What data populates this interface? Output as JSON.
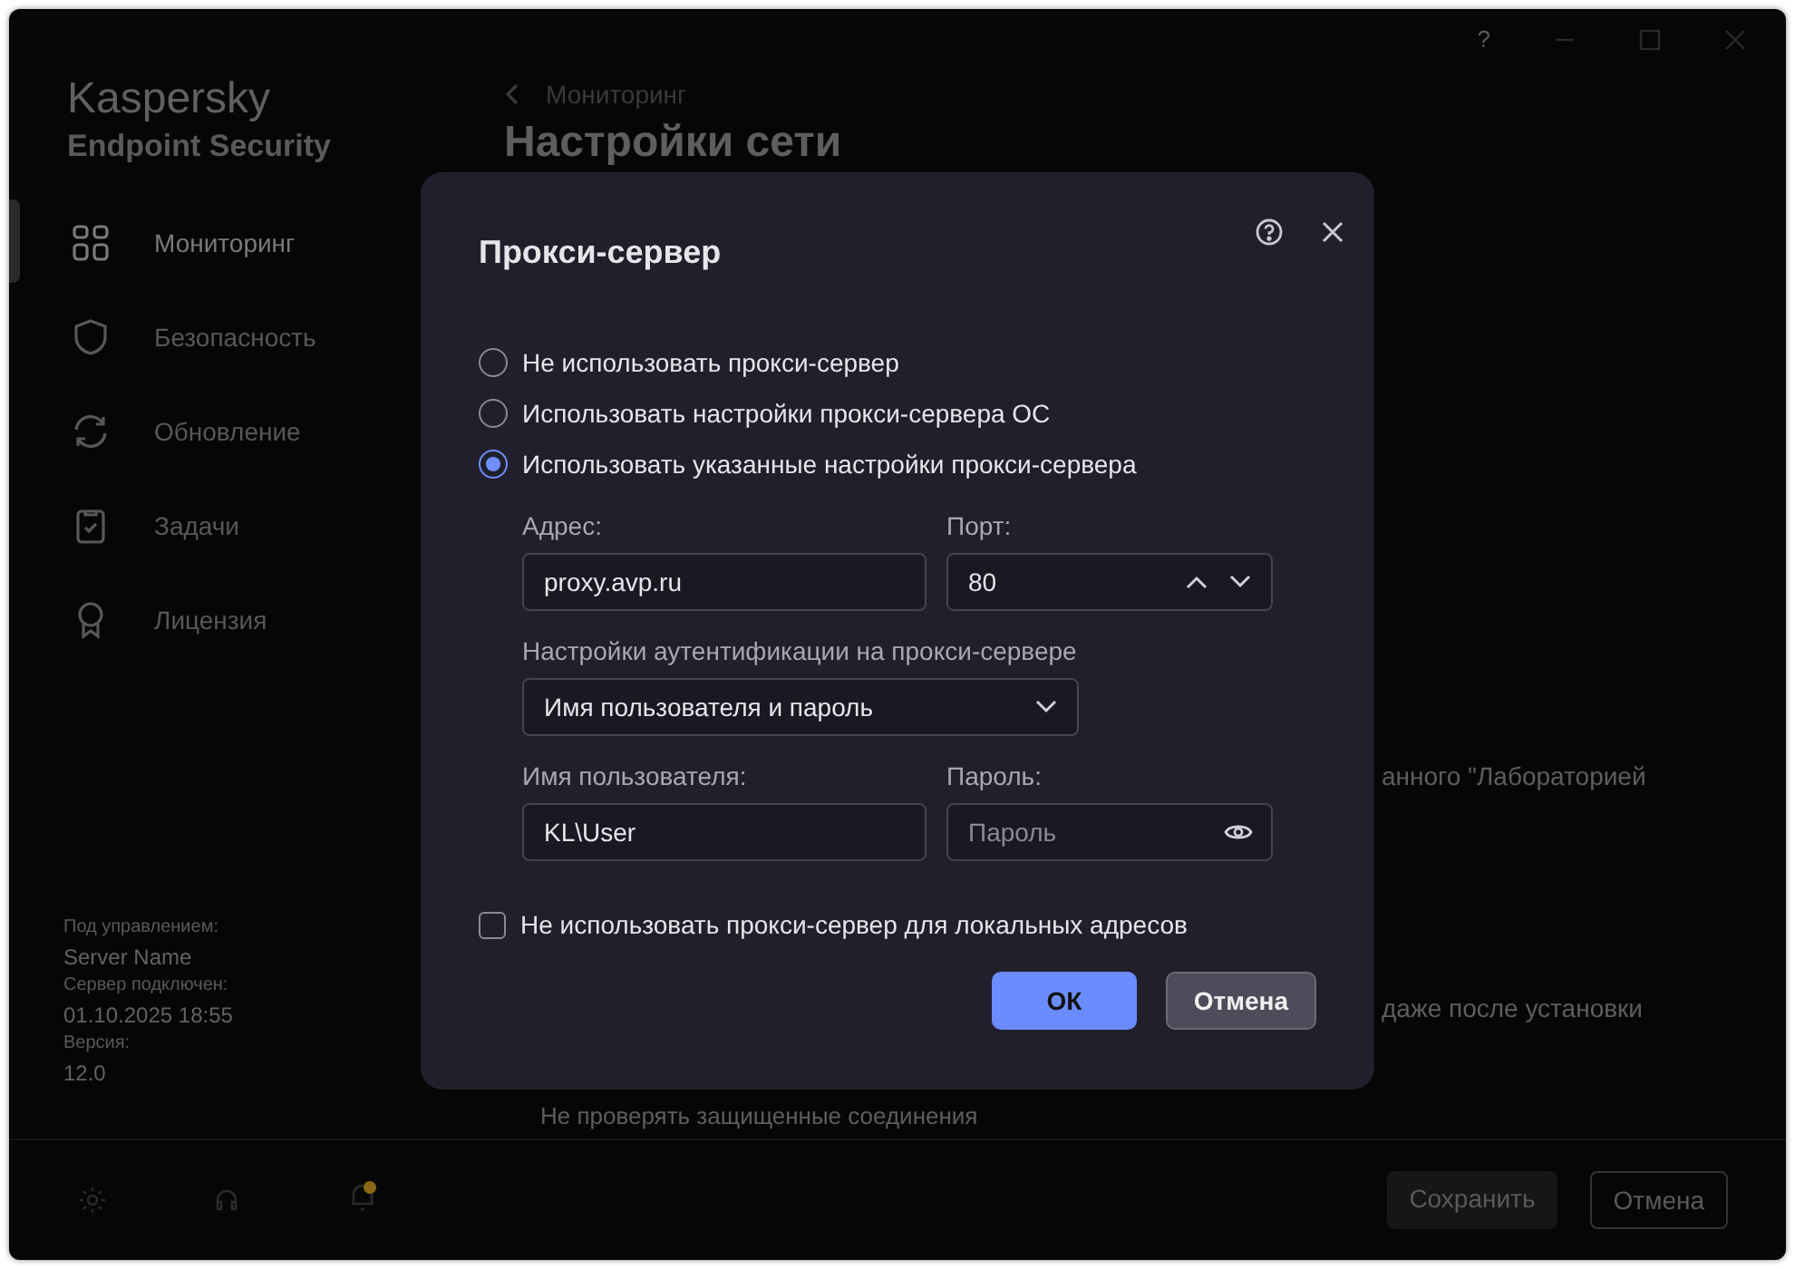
{
  "window": {
    "help": "?"
  },
  "sidebar": {
    "brand": "Kaspersky",
    "product": "Endpoint Security",
    "items": [
      {
        "label": "Мониторинг",
        "selected": true
      },
      {
        "label": "Безопасность",
        "selected": false
      },
      {
        "label": "Обновление",
        "selected": false
      },
      {
        "label": "Задачи",
        "selected": false
      },
      {
        "label": "Лицензия",
        "selected": false
      }
    ],
    "info": [
      {
        "label": "Под управлением:",
        "value": "Server Name"
      },
      {
        "label": "Сервер подключен:",
        "value": "01.10.2025 18:55"
      },
      {
        "label": "Версия:",
        "value": "12.0"
      }
    ],
    "notification_badge": true
  },
  "page": {
    "back": "Мониторинг",
    "title": "Настройки сети",
    "fragments": [
      "анного \"Лабораторией",
      "даже после установки",
      "Не проверять защищенные соединения"
    ],
    "buttons": [
      {
        "label": "Сохранить",
        "kind": "primary"
      },
      {
        "label": "Отмена",
        "kind": "secondary"
      }
    ]
  },
  "dialog": {
    "title": "Прокси-сервер",
    "options": [
      {
        "label": "Не использовать прокси-сервер",
        "selected": false
      },
      {
        "label": "Использовать настройки прокси-сервера ОС",
        "selected": false
      },
      {
        "label": "Использовать указанные настройки прокси-сервера",
        "selected": true
      }
    ],
    "address": {
      "label": "Адрес:",
      "value": "proxy.avp.ru"
    },
    "port": {
      "label": "Порт:",
      "value": "80"
    },
    "auth": {
      "label": "Настройки аутентификации на прокси-сервере",
      "value": "Имя пользователя и пароль"
    },
    "username": {
      "label": "Имя пользователя:",
      "value": "KL\\User"
    },
    "password": {
      "label": "Пароль:",
      "placeholder": "Пароль"
    },
    "bypass_local": {
      "label": "Не использовать прокси-сервер для локальных адресов",
      "checked": false
    },
    "buttons": [
      {
        "label": "ОК",
        "kind": "primary"
      },
      {
        "label": "Отмена",
        "kind": "secondary"
      }
    ]
  }
}
